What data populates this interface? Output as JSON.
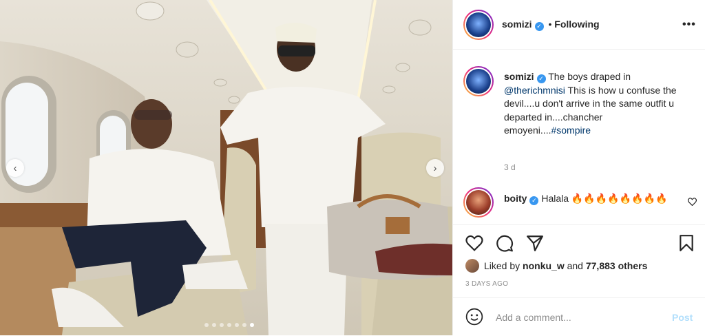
{
  "post": {
    "image_alt": "Two men in white outfits inside a private jet cabin",
    "carousel": {
      "slide_count": 7,
      "active_index": 6
    }
  },
  "header": {
    "username": "somizi",
    "separator": "•",
    "follow_status": "Following",
    "more_icon": "more-horizontal-icon"
  },
  "caption": {
    "username": "somizi",
    "text_intro": "The boys draped in",
    "mention": "@therichmnisi",
    "text_body": "This is how u confuse the devil....u don't arrive in the same outfit u departed in....chancher emoyeni....",
    "hashtag": "#sompire",
    "time": "3 d"
  },
  "comment": {
    "username": "boity",
    "text": "Halala 🔥🔥🔥🔥🔥🔥🔥🔥"
  },
  "likes": {
    "prefix": "Liked by",
    "user": "nonku_w",
    "and": "and",
    "count": "77,883 others"
  },
  "timestamp": "3 DAYS AGO",
  "add_comment": {
    "placeholder": "Add a comment...",
    "post_label": "Post"
  },
  "colors": {
    "verified": "#3897f0",
    "link": "#00376b",
    "post_disabled": "#b2dffc"
  }
}
